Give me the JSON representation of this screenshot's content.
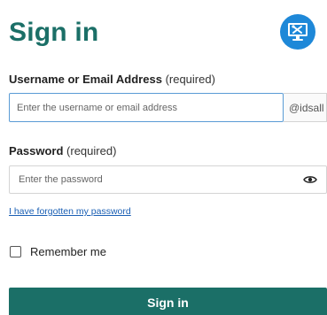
{
  "header": {
    "title": "Sign in",
    "logo_icon": "computer-tools-icon",
    "logo_color": "#1e88d8"
  },
  "username": {
    "label": "Username or Email Address",
    "required": "(required)",
    "placeholder": "Enter the username or email address",
    "value": "",
    "suffix": "@idsall"
  },
  "password": {
    "label": "Password",
    "required": "(required)",
    "placeholder": "Enter the password",
    "value": "",
    "toggle_icon": "eye-icon"
  },
  "forgot_link": "I have forgotten my password",
  "remember": {
    "label": "Remember me",
    "checked": false
  },
  "submit_label": "Sign in",
  "colors": {
    "brand": "#1b6f67",
    "focus_border": "#5a9bd5",
    "link": "#1a5fb4"
  }
}
